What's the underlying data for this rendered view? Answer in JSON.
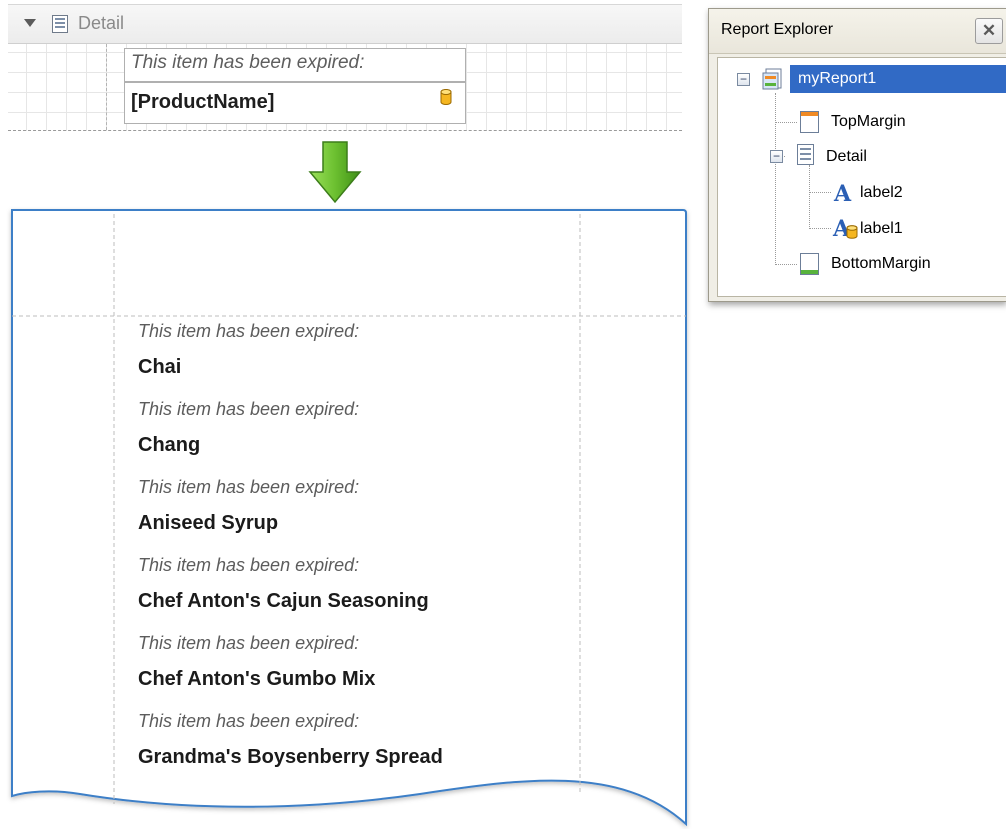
{
  "designer": {
    "band_label": "Detail",
    "label2_text": "This item has been expired:",
    "label1_text": "[ProductName]"
  },
  "preview": {
    "items": [
      {
        "caption": "This item has been expired:",
        "product": "Chai"
      },
      {
        "caption": "This item has been expired:",
        "product": "Chang"
      },
      {
        "caption": "This item has been expired:",
        "product": "Aniseed Syrup"
      },
      {
        "caption": "This item has been expired:",
        "product": "Chef Anton's Cajun Seasoning"
      },
      {
        "caption": "This item has been expired:",
        "product": "Chef Anton's Gumbo Mix"
      },
      {
        "caption": "This item has been expired:",
        "product": "Grandma's Boysenberry Spread"
      }
    ]
  },
  "explorer": {
    "title": "Report Explorer",
    "close_glyph": "✕",
    "tree": {
      "root": "myReport1",
      "top_margin": "TopMargin",
      "detail": "Detail",
      "label2": "label2",
      "label1": "label1",
      "bottom_margin": "BottomMargin"
    }
  },
  "colors": {
    "selection": "#316ac5",
    "arrow_green": "#6cc030",
    "page_border": "#3d7fc7"
  }
}
